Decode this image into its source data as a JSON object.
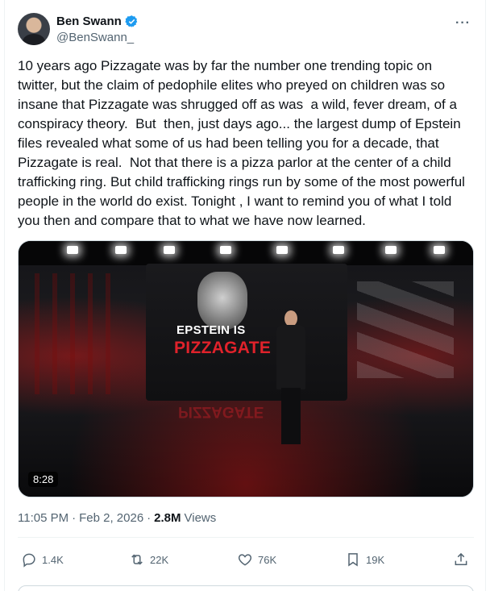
{
  "author": {
    "display_name": "Ben Swann",
    "handle": "@BenSwann_",
    "verified_icon": "verified-badge-icon",
    "verified_color": "#1d9bf0"
  },
  "tweet": {
    "text": "10 years ago Pizzagate was by far the number one trending topic on twitter, but the claim of pedophile elites who preyed on children was so insane that Pizzagate was shrugged off as was  a wild, fever dream, of a conspiracy theory.  But  then, just days ago... the largest dump of Epstein files revealed what some of us had been telling you for a decade, that Pizzagate is real.  Not that there is a pizza parlor at the center of a child trafficking ring. But child trafficking rings run by some of the most powerful people in the world do exist. Tonight , I want to remind you of what I told you then and compare that to what we have now learned."
  },
  "media": {
    "title_line_1": "EPSTEIN IS",
    "title_line_2": "PIZZAGATE",
    "reflection_text": "PIZZAGATE",
    "duration": "8:28",
    "accent_color": "#e0222b"
  },
  "meta": {
    "time": "11:05 PM",
    "date": "Feb 2, 2026",
    "views_count": "2.8M",
    "views_label": "Views",
    "separator": "·"
  },
  "actions": {
    "replies": "1.4K",
    "reposts": "22K",
    "likes": "76K",
    "bookmarks": "19K"
  }
}
